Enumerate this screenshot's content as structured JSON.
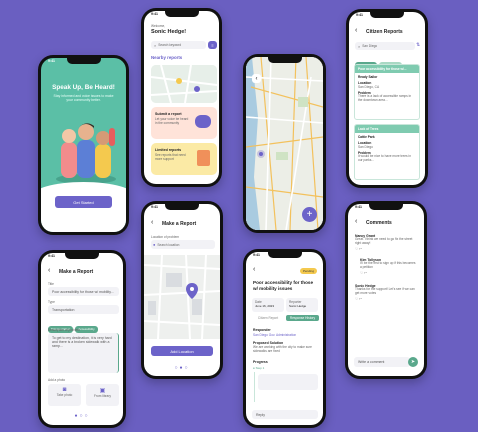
{
  "colors": {
    "background": "#6a5fc1",
    "accent": "#6c63c9",
    "teal": "#5bbfa6",
    "green": "#5aa88c",
    "yellow": "#f4c94e"
  },
  "status_time": "9:41",
  "onboarding": {
    "title": "Speak Up, Be Heard!",
    "subtitle": "Stay informed and voice issues to make your community better.",
    "cta": "Get Started"
  },
  "home": {
    "welcome": "Welcome,",
    "user_name": "Sonic Hedge!",
    "search_placeholder": "Search keyword",
    "section_title": "Nearby reports",
    "card1_title": "Submit a report",
    "card1_text": "Let your voice be heard in the community",
    "card2_title": "Limited reports",
    "card2_text": "See reports that need more support"
  },
  "reports": {
    "title": "Citizen Reports",
    "search_value": "San Diego",
    "tabs": [
      "Accessibility",
      "Environment"
    ],
    "report1_title": "Poor accessibility for those w/...",
    "report1_reporter_label": "Ready Sailor",
    "report1_location_label": "Location",
    "report1_location": "San Diego, CA",
    "report1_problem_label": "Problem",
    "report1_problem": "There is a lack of accessible ramps in the downtown area...",
    "report2_title": "Lack of Trees",
    "report2_reporter_label": "Cattie Park",
    "report2_location_label": "Location",
    "report2_location": "San Diego",
    "report2_problem_label": "Problem",
    "report2_problem": "It would be nice to have more trees in our parks..."
  },
  "make_report": {
    "title": "Make a Report",
    "title_label": "Title",
    "title_value": "Poor accessibility for those w/ mobility...",
    "type_label": "Type",
    "type_value": "Transportation",
    "chips": [
      "Transportation",
      "Accessibility"
    ],
    "desc_label": "Description of problem",
    "desc_value": "To get to my destination, it is very hard and there is a broken sidewalk with a ramp...",
    "photo_label": "Add a photo",
    "photo_btn1": "Take photo",
    "photo_btn2": "From library"
  },
  "make_report_map": {
    "title": "Make a Report",
    "location_label": "Location of problem",
    "location_placeholder": "Search location",
    "cta": "Add Location"
  },
  "report_detail": {
    "badge": "Pending",
    "title": "Poor accessibility for those w/ mobility issues",
    "stat1_label": "Date",
    "stat1_value": "June 16, 2023",
    "stat2_label": "Reporter",
    "stat2_value": "Sonic Hedge",
    "tab1": "Citizen Report",
    "tab2": "Response History",
    "responder_label": "Responder",
    "responder_value": "San Diego Gov. Administration",
    "proposed_label": "Proposed Solution",
    "proposed_value": "We are working with the city to make sure sidewalks are fixed",
    "progress_label": "Progress",
    "progress_value": "Step 1",
    "reply_placeholder": "Reply"
  },
  "comments": {
    "title": "Comments",
    "c1_name": "Nancy Grant",
    "c1_text": "Great. I think we need to go fix the street right away!",
    "c2_name": "Kim Tollyson",
    "c2_text": "I'll be the first to sign up if this becomes a petition",
    "c3_name": "Sonic Hedge",
    "c3_text": "Thanks for the support! Let's see if we can get more votes",
    "input_placeholder": "Write a comment"
  }
}
